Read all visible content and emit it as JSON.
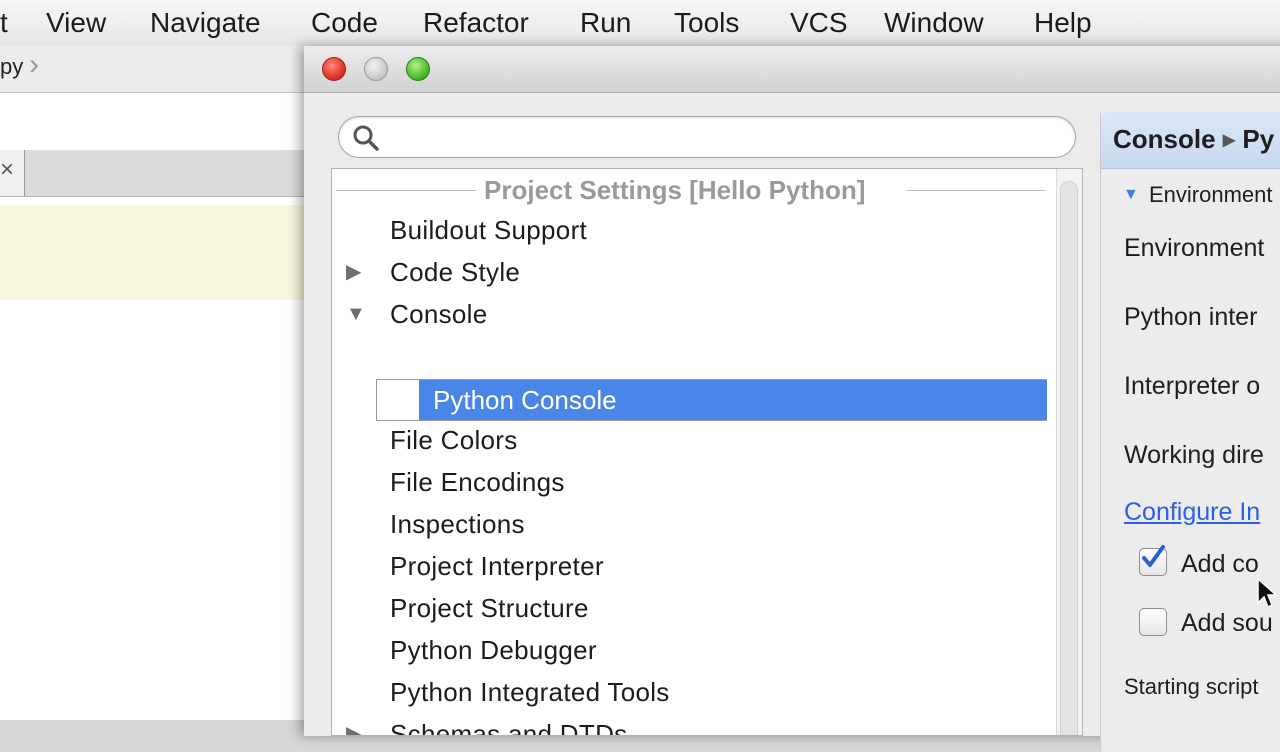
{
  "menubar": {
    "items": [
      "t",
      "View",
      "Navigate",
      "Code",
      "Refactor",
      "Run",
      "Tools",
      "VCS",
      "Window",
      "Help"
    ]
  },
  "editor": {
    "breadcrumb": "py",
    "tab_close": "×"
  },
  "dialog": {
    "search": {
      "value": "",
      "placeholder": ""
    },
    "tree": {
      "header": "Project Settings [Hello Python]",
      "items": [
        {
          "label": "Buildout Support"
        },
        {
          "label": "Code Style",
          "arrow": "▶"
        },
        {
          "label": "Console",
          "arrow": "▼"
        },
        {
          "label": "Python Console",
          "selected": true
        },
        {
          "label": "File Colors"
        },
        {
          "label": "File Encodings"
        },
        {
          "label": "Inspections"
        },
        {
          "label": "Project Interpreter"
        },
        {
          "label": "Project Structure"
        },
        {
          "label": "Python Debugger"
        },
        {
          "label": "Python Integrated Tools"
        },
        {
          "label": "Schemas and DTDs",
          "arrow": "▶"
        }
      ]
    },
    "right_panel": {
      "breadcrumb_first": "Console",
      "breadcrumb_sep": "▶",
      "breadcrumb_second": "Py",
      "section_arrow": "▼",
      "section_title": "Environment",
      "env_label": "Environment",
      "interpreter_label": "Python inter",
      "interpreter_options_label": "Interpreter o",
      "working_dir_label": "Working dire",
      "configure_link": "Configure In",
      "add_content_roots": {
        "label": "Add co",
        "checked": true
      },
      "add_source_roots": {
        "label": "Add sou",
        "checked": false
      },
      "starting_script_label": "Starting script"
    }
  },
  "colors": {
    "selection": "#4a86e8",
    "link": "#2a5fe8",
    "current_line": "#f8f7dc"
  }
}
